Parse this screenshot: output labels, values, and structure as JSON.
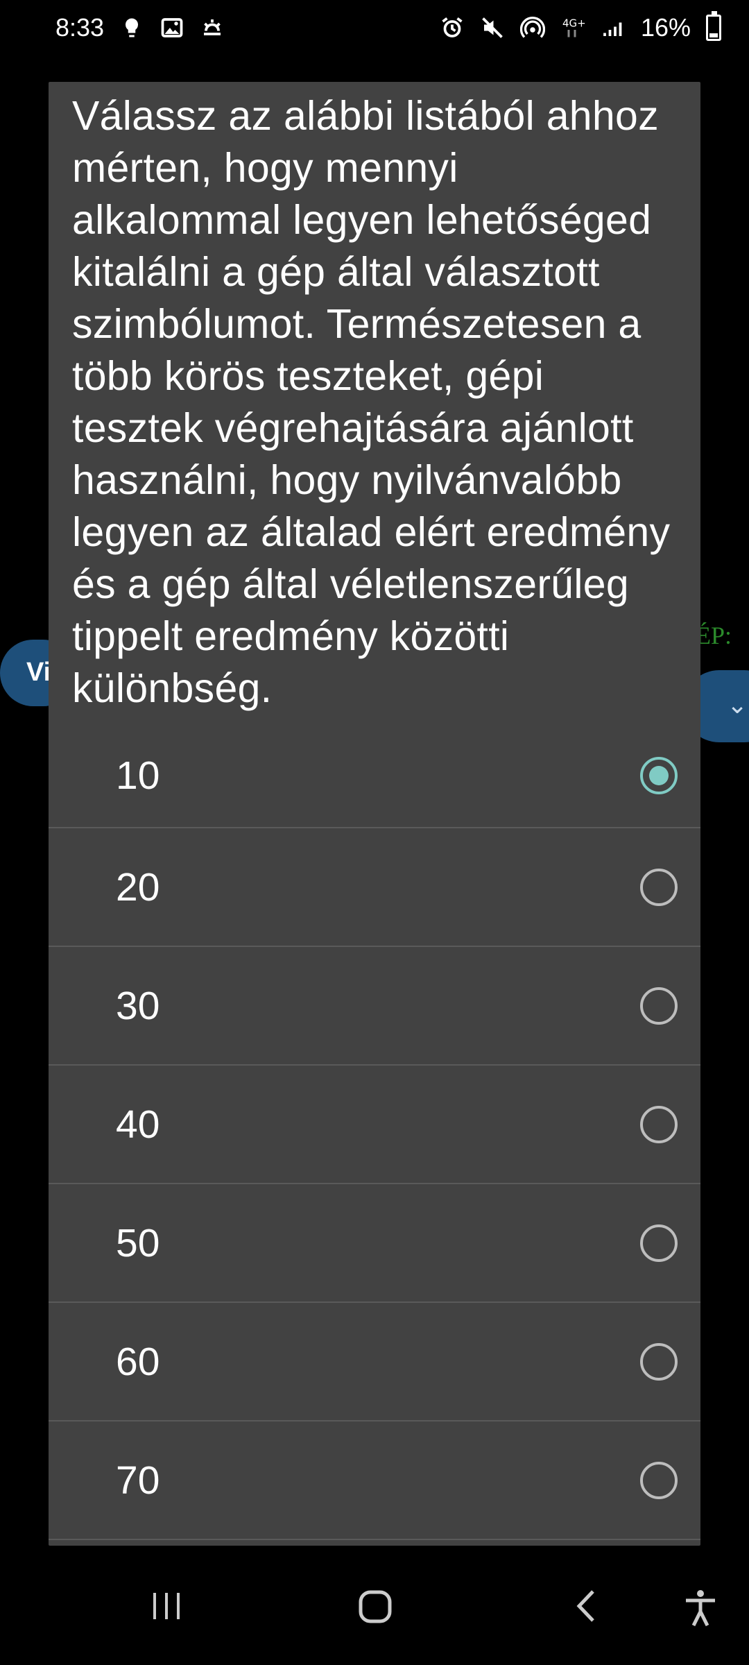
{
  "status_bar": {
    "time": "8:33",
    "left_icons": [
      "bulb-icon",
      "image-icon",
      "weather-icon"
    ],
    "right_icons": [
      "alarm-icon",
      "mute-icon",
      "hotspot-icon",
      "4g-icon",
      "signal-icon"
    ],
    "battery": "16%"
  },
  "background": {
    "left_button_text": "Vi",
    "right_label": "ÉP:"
  },
  "dialog": {
    "message": "Válassz az alábbi listából ahhoz mérten, hogy mennyi alkalommal legyen lehetőséged kitalálni a gép által választott szimbólumot. Természetesen a több körös teszteket, gépi tesztek végrehajtására ajánlott használni, hogy nyilvánvalóbb legyen az általad elért eredmény és a gép által véletlenszerűleg tippelt eredmény közötti különbség.",
    "options": [
      {
        "label": "10",
        "selected": true
      },
      {
        "label": "20",
        "selected": false
      },
      {
        "label": "30",
        "selected": false
      },
      {
        "label": "40",
        "selected": false
      },
      {
        "label": "50",
        "selected": false
      },
      {
        "label": "60",
        "selected": false
      },
      {
        "label": "70",
        "selected": false
      }
    ],
    "accent_color": "#80cbc4"
  },
  "nav_bar": {
    "buttons": [
      "recent-apps-icon",
      "home-icon",
      "back-icon",
      "accessibility-icon"
    ]
  }
}
